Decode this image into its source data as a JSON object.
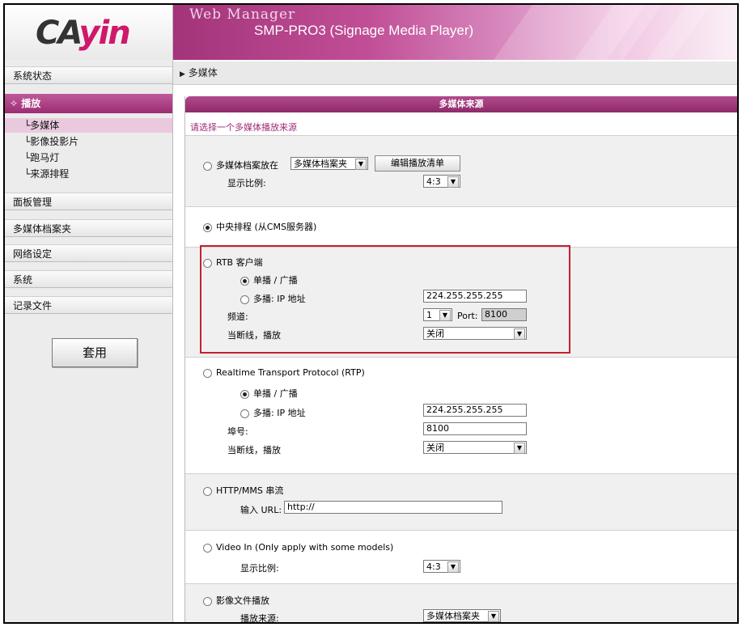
{
  "header": {
    "logo_text_1": "CA",
    "logo_text_2": "yin",
    "title": "Web Manager",
    "subtitle": "SMP-PRO3 (Signage Media Player)"
  },
  "sidebar": {
    "items": [
      {
        "label": "系统状态"
      },
      {
        "label": "播放"
      },
      {
        "label": "面板管理"
      },
      {
        "label": "多媒体档案夹"
      },
      {
        "label": "网络设定"
      },
      {
        "label": "系统"
      },
      {
        "label": "记录文件"
      }
    ],
    "active_prefix": "✧",
    "subitems": [
      {
        "label": "└多媒体"
      },
      {
        "label": "└影像投影片"
      },
      {
        "label": "└跑马灯"
      },
      {
        "label": "└来源排程"
      }
    ],
    "apply_label": "套用"
  },
  "breadcrumb": {
    "arrow": "▶",
    "label": "多媒体"
  },
  "panel": {
    "title": "多媒体来源",
    "hint": "请选择一个多媒体播放来源",
    "media_folder": {
      "label": "多媒体档案放在",
      "select_value": "多媒体档案夹",
      "edit_button": "编辑播放清单",
      "ratio_label": "显示比例:",
      "ratio_value": "4:3"
    },
    "cms": {
      "label": "中央排程 (从CMS服务器)"
    },
    "rtb": {
      "label": "RTB 客户端",
      "unicast_label": "单播 / 广播",
      "multicast_label": "多播: IP 地址",
      "ip_value": "224.255.255.255",
      "channel_label": "频道:",
      "channel_value": "1",
      "port_label": "Port:",
      "port_value": "8100",
      "offline_label": "当断线，播放",
      "offline_value": "关闭"
    },
    "rtp": {
      "label": "Realtime Transport Protocol (RTP)",
      "unicast_label": "单播 / 广播",
      "multicast_label": "多播: IP 地址",
      "ip_value": "224.255.255.255",
      "port_label": "埠号:",
      "port_value": "8100",
      "offline_label": "当断线，播放",
      "offline_value": "关闭"
    },
    "http": {
      "label": "HTTP/MMS 串流",
      "url_label": "输入 URL:",
      "url_value": "http://"
    },
    "video_in": {
      "label": "Video In (Only apply with some models)",
      "ratio_label": "显示比例:",
      "ratio_value": "4:3"
    },
    "image_file": {
      "label": "影像文件播放",
      "source_label": "播放来源:",
      "source_value": "多媒体档案夹"
    }
  },
  "colors": {
    "accent": "#a3347a",
    "highlight": "#c6202e"
  }
}
